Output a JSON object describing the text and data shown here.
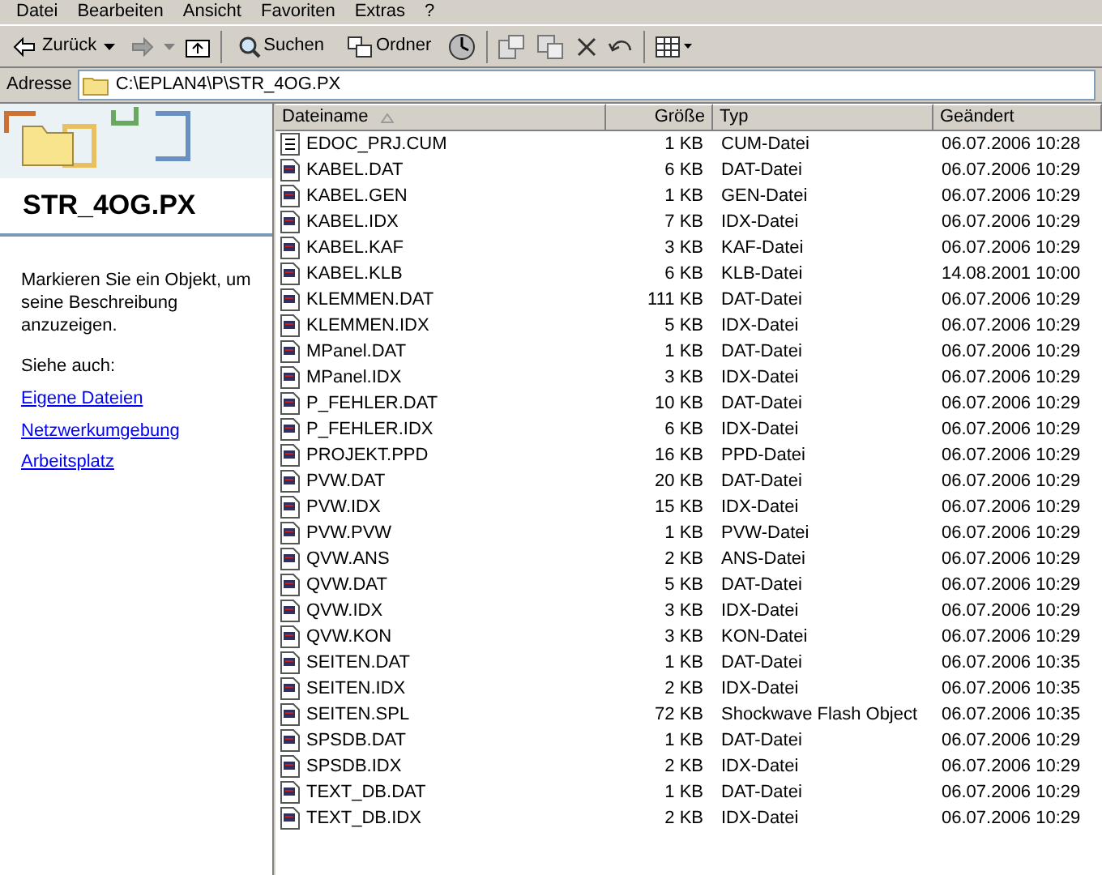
{
  "menu": [
    "Datei",
    "Bearbeiten",
    "Ansicht",
    "Favoriten",
    "Extras",
    "?"
  ],
  "toolbar": {
    "back": "Zurück",
    "search": "Suchen",
    "folders": "Ordner"
  },
  "address": {
    "label": "Adresse",
    "value": "C:\\EPLAN4\\P\\STR_4OG.PX"
  },
  "side_panel": {
    "title": "STR_4OG.PX",
    "description": "Markieren Sie ein Objekt, um seine Beschreibung anzuzeigen.",
    "see_also": "Siehe auch:",
    "links": [
      "Eigene Dateien",
      "Netzwerkumgebung",
      "Arbeitsplatz"
    ]
  },
  "table": {
    "columns": [
      "Dateiname",
      "Größe",
      "Typ",
      "Geändert"
    ],
    "rows": [
      {
        "kind": "text",
        "name": "EDOC_PRJ.CUM",
        "size": "1 KB",
        "type": "CUM-Datei",
        "modified": "06.07.2006 10:28"
      },
      {
        "kind": "app",
        "name": "KABEL.DAT",
        "size": "6 KB",
        "type": "DAT-Datei",
        "modified": "06.07.2006 10:29"
      },
      {
        "kind": "app",
        "name": "KABEL.GEN",
        "size": "1 KB",
        "type": "GEN-Datei",
        "modified": "06.07.2006 10:29"
      },
      {
        "kind": "app",
        "name": "KABEL.IDX",
        "size": "7 KB",
        "type": "IDX-Datei",
        "modified": "06.07.2006 10:29"
      },
      {
        "kind": "app",
        "name": "KABEL.KAF",
        "size": "3 KB",
        "type": "KAF-Datei",
        "modified": "06.07.2006 10:29"
      },
      {
        "kind": "app",
        "name": "KABEL.KLB",
        "size": "6 KB",
        "type": "KLB-Datei",
        "modified": "14.08.2001 10:00"
      },
      {
        "kind": "app",
        "name": "KLEMMEN.DAT",
        "size": "111 KB",
        "type": "DAT-Datei",
        "modified": "06.07.2006 10:29"
      },
      {
        "kind": "app",
        "name": "KLEMMEN.IDX",
        "size": "5 KB",
        "type": "IDX-Datei",
        "modified": "06.07.2006 10:29"
      },
      {
        "kind": "app",
        "name": "MPanel.DAT",
        "size": "1 KB",
        "type": "DAT-Datei",
        "modified": "06.07.2006 10:29"
      },
      {
        "kind": "app",
        "name": "MPanel.IDX",
        "size": "3 KB",
        "type": "IDX-Datei",
        "modified": "06.07.2006 10:29"
      },
      {
        "kind": "app",
        "name": "P_FEHLER.DAT",
        "size": "10 KB",
        "type": "DAT-Datei",
        "modified": "06.07.2006 10:29"
      },
      {
        "kind": "app",
        "name": "P_FEHLER.IDX",
        "size": "6 KB",
        "type": "IDX-Datei",
        "modified": "06.07.2006 10:29"
      },
      {
        "kind": "app",
        "name": "PROJEKT.PPD",
        "size": "16 KB",
        "type": "PPD-Datei",
        "modified": "06.07.2006 10:29"
      },
      {
        "kind": "app",
        "name": "PVW.DAT",
        "size": "20 KB",
        "type": "DAT-Datei",
        "modified": "06.07.2006 10:29"
      },
      {
        "kind": "app",
        "name": "PVW.IDX",
        "size": "15 KB",
        "type": "IDX-Datei",
        "modified": "06.07.2006 10:29"
      },
      {
        "kind": "app",
        "name": "PVW.PVW",
        "size": "1 KB",
        "type": "PVW-Datei",
        "modified": "06.07.2006 10:29"
      },
      {
        "kind": "app",
        "name": "QVW.ANS",
        "size": "2 KB",
        "type": "ANS-Datei",
        "modified": "06.07.2006 10:29"
      },
      {
        "kind": "app",
        "name": "QVW.DAT",
        "size": "5 KB",
        "type": "DAT-Datei",
        "modified": "06.07.2006 10:29"
      },
      {
        "kind": "app",
        "name": "QVW.IDX",
        "size": "3 KB",
        "type": "IDX-Datei",
        "modified": "06.07.2006 10:29"
      },
      {
        "kind": "app",
        "name": "QVW.KON",
        "size": "3 KB",
        "type": "KON-Datei",
        "modified": "06.07.2006 10:29"
      },
      {
        "kind": "app",
        "name": "SEITEN.DAT",
        "size": "1 KB",
        "type": "DAT-Datei",
        "modified": "06.07.2006 10:35"
      },
      {
        "kind": "app",
        "name": "SEITEN.IDX",
        "size": "2 KB",
        "type": "IDX-Datei",
        "modified": "06.07.2006 10:35"
      },
      {
        "kind": "app",
        "name": "SEITEN.SPL",
        "size": "72 KB",
        "type": "Shockwave Flash Object",
        "modified": "06.07.2006 10:35"
      },
      {
        "kind": "app",
        "name": "SPSDB.DAT",
        "size": "1 KB",
        "type": "DAT-Datei",
        "modified": "06.07.2006 10:29"
      },
      {
        "kind": "app",
        "name": "SPSDB.IDX",
        "size": "2 KB",
        "type": "IDX-Datei",
        "modified": "06.07.2006 10:29"
      },
      {
        "kind": "app",
        "name": "TEXT_DB.DAT",
        "size": "1 KB",
        "type": "DAT-Datei",
        "modified": "06.07.2006 10:29"
      },
      {
        "kind": "app",
        "name": "TEXT_DB.IDX",
        "size": "2 KB",
        "type": "IDX-Datei",
        "modified": "06.07.2006 10:29"
      }
    ]
  }
}
